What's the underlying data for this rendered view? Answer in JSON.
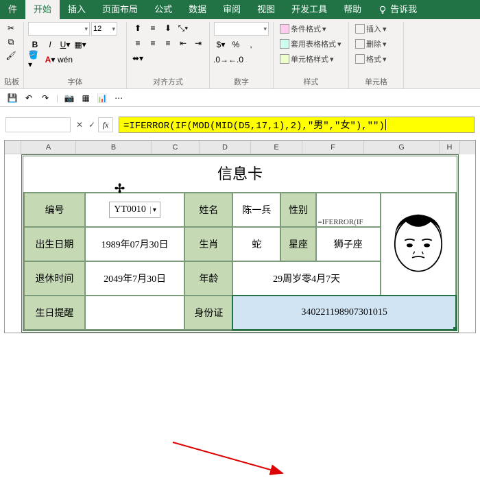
{
  "ribbon": {
    "tabs": [
      "件",
      "开始",
      "插入",
      "页面布局",
      "公式",
      "数据",
      "审阅",
      "视图",
      "开发工具",
      "帮助"
    ],
    "active_tab": "开始",
    "tell_me": "告诉我",
    "groups": {
      "clipboard": {
        "label": "贴板",
        "fmt_painter": "格式刷"
      },
      "font": {
        "label": "字体",
        "font_name": "",
        "font_size": "12"
      },
      "align": {
        "label": "对齐方式"
      },
      "number": {
        "label": "数字",
        "format": ""
      },
      "styles": {
        "label": "样式",
        "cond_fmt": "条件格式",
        "tbl_fmt": "套用表格格式",
        "cell_style": "单元格样式"
      },
      "cells": {
        "label": "单元格",
        "insert": "插入",
        "delete": "删除",
        "format": "格式"
      }
    }
  },
  "formula_bar": {
    "formula": "=IFERROR(IF(MOD(MID(D5,17,1),2),\"男\",\"女\"),\"\")"
  },
  "sheet": {
    "columns": [
      "A",
      "B",
      "C",
      "D",
      "E",
      "F",
      "G",
      "H"
    ],
    "title": "信息卡",
    "overflow_formula": "=IFERROR(IF",
    "rows": {
      "r1": {
        "c1": "编号",
        "c2": "YT0010",
        "c3": "姓名",
        "c4": "陈一兵",
        "c5": "性别",
        "c6": ""
      },
      "r2": {
        "c1": "出生日期",
        "c2": "1989年07月30日",
        "c3": "生肖",
        "c4": "蛇",
        "c5": "星座",
        "c6": "狮子座"
      },
      "r3": {
        "c1": "退休时间",
        "c2": "2049年7月30日",
        "c3": "年龄",
        "c4": "29周岁零4月7天"
      },
      "r4": {
        "c1": "生日提醒",
        "c2": "",
        "c3": "身份证",
        "c4": "340221198907301015"
      }
    }
  }
}
